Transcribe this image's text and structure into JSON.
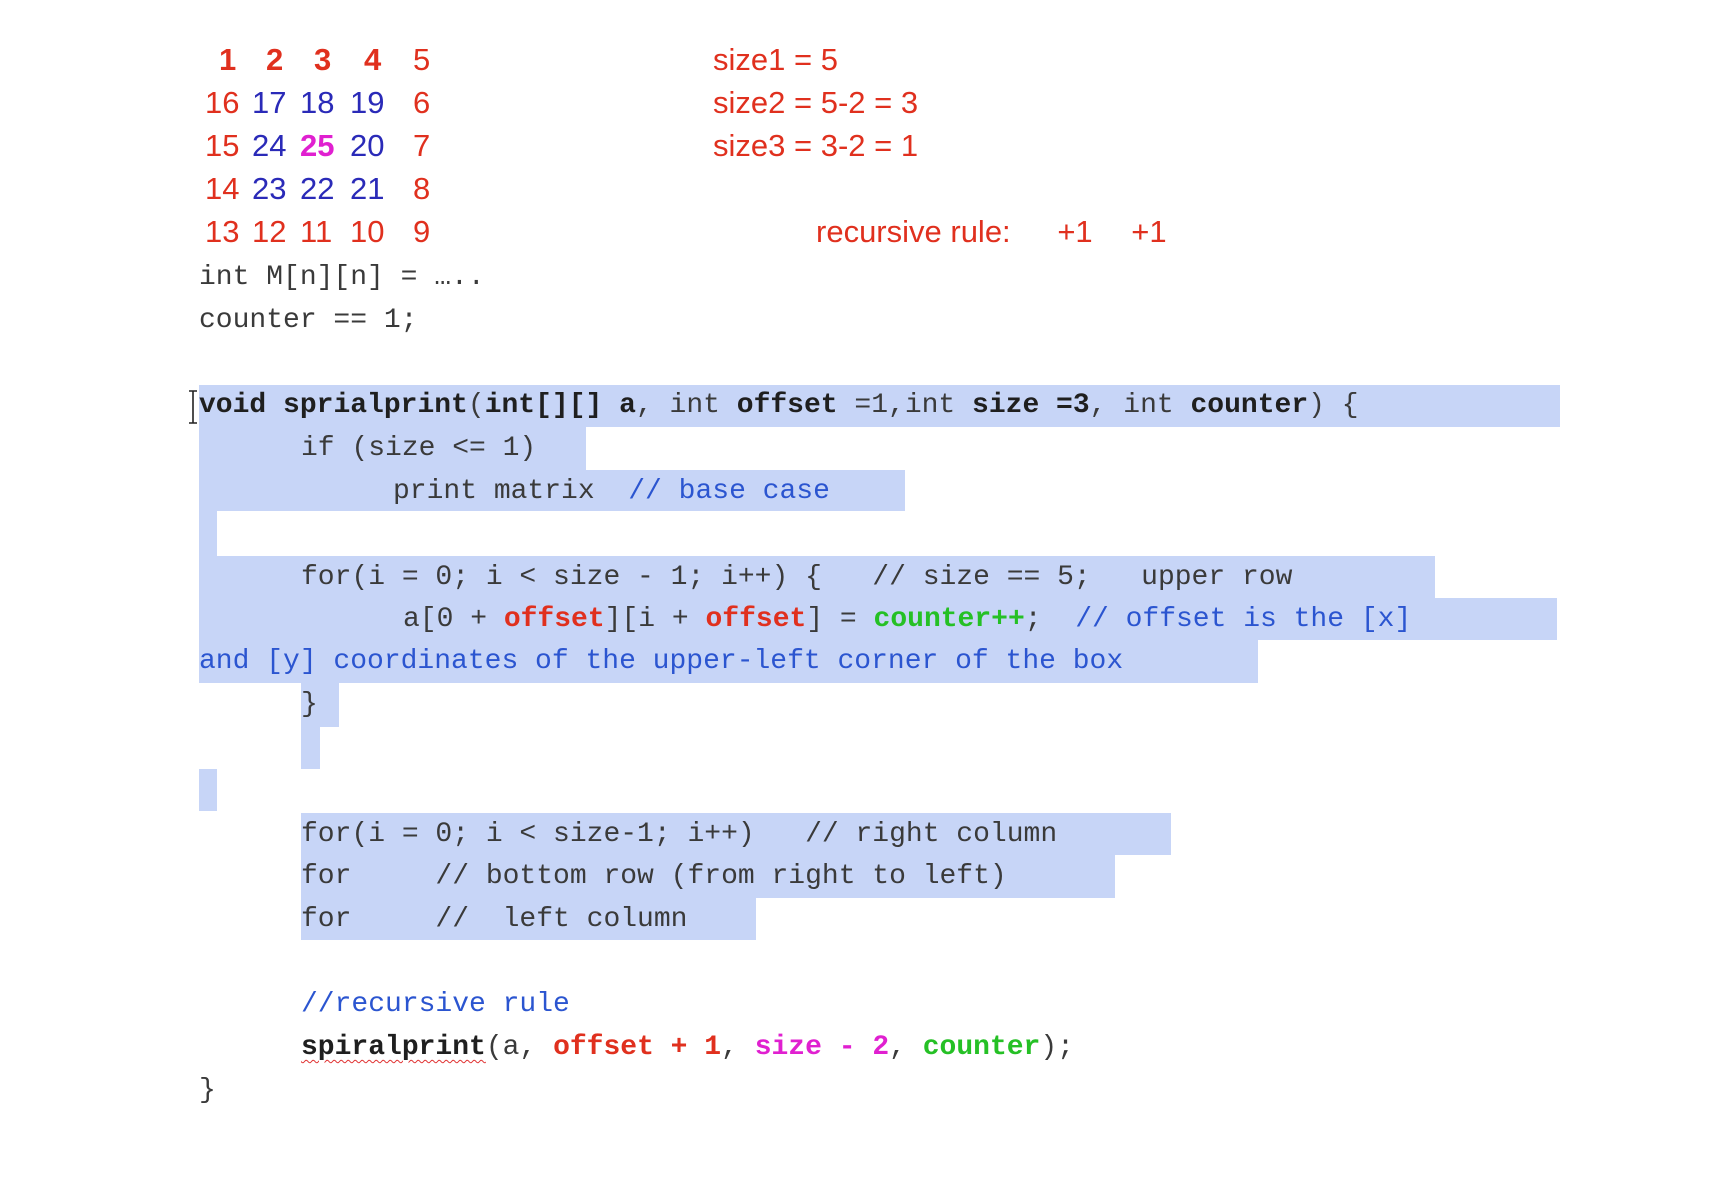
{
  "matrix": {
    "rows": [
      [
        {
          "t": "1",
          "c": "#e0301e",
          "b": true
        },
        {
          "t": "2",
          "c": "#e0301e",
          "b": true
        },
        {
          "t": "3",
          "c": "#e0301e",
          "b": true
        },
        {
          "t": "4",
          "c": "#e0301e",
          "b": true
        },
        {
          "t": "5",
          "c": "#e0301e",
          "b": false
        }
      ],
      [
        {
          "t": "16",
          "c": "#e0301e",
          "b": false
        },
        {
          "t": "17",
          "c": "#2a2ab8",
          "b": false
        },
        {
          "t": "18",
          "c": "#2a2ab8",
          "b": false
        },
        {
          "t": "19",
          "c": "#2a2ab8",
          "b": false
        },
        {
          "t": "6",
          "c": "#e0301e",
          "b": false
        }
      ],
      [
        {
          "t": "15",
          "c": "#e0301e",
          "b": false
        },
        {
          "t": "24",
          "c": "#2a2ab8",
          "b": false
        },
        {
          "t": "25",
          "c": "#e020d0",
          "b": true
        },
        {
          "t": "20",
          "c": "#2a2ab8",
          "b": false
        },
        {
          "t": "7",
          "c": "#e0301e",
          "b": false
        }
      ],
      [
        {
          "t": "14",
          "c": "#e0301e",
          "b": false
        },
        {
          "t": "23",
          "c": "#2a2ab8",
          "b": false
        },
        {
          "t": "22",
          "c": "#2a2ab8",
          "b": false
        },
        {
          "t": "21",
          "c": "#2a2ab8",
          "b": false
        },
        {
          "t": "8",
          "c": "#e0301e",
          "b": false
        }
      ],
      [
        {
          "t": "13",
          "c": "#e0301e",
          "b": false
        },
        {
          "t": "12",
          "c": "#e0301e",
          "b": false
        },
        {
          "t": "11",
          "c": "#e0301e",
          "b": false
        },
        {
          "t": "10",
          "c": "#e0301e",
          "b": false
        },
        {
          "t": "9",
          "c": "#e0301e",
          "b": false
        }
      ]
    ]
  },
  "sizes": [
    "size1 = 5",
    "size2 = 5-2 = 3",
    "size3 = 3-2 = 1"
  ],
  "recursive_rule": {
    "label": "recursive rule:",
    "v1": "+1",
    "v2": "+1"
  },
  "code": {
    "l1": "int M[n][n] = …..",
    "l2": "counter == 1;",
    "sig": {
      "void": "void",
      "name": "sprialprint",
      "p1": "(",
      "type1": "int[][]",
      "sp1": " ",
      "a": "a",
      "c1": ", ",
      "int2": "int ",
      "offset": "offset",
      "eq1": " =1,",
      "int3": "int ",
      "size": "size",
      "eq3": " =3",
      "c2": ", ",
      "int4": "int ",
      "counter": "counter",
      "close": ") {"
    },
    "if_line": "if (size <= 1)",
    "print_line": "print matrix  ",
    "base_case": "// base case",
    "for1": "for(i = 0; i < size - 1; i++) {   ",
    "for1_cmt": "// size == 5;   upper row",
    "assign": {
      "a0": "a[0 + ",
      "off1": "offset",
      "mid": "][i + ",
      "off2": "offset",
      "eq": "] = ",
      "cnt": "counter++",
      "semi": ";  ",
      "cmt": "// offset is the [x]"
    },
    "cont_cmt": "and [y] coordinates of the upper-left corner of the box",
    "close_brace": "}",
    "for_right": "for(i = 0; i < size-1; i++)   // right column",
    "for_bottom": "for     // bottom row (from right to left)",
    "for_left": "for     //  left column",
    "rec_cmt": "//recursive rule",
    "call": {
      "name": "spiralprint",
      "p": "(a, ",
      "off": "offset + 1",
      "c1": ", ",
      "size": "size - 2",
      "c2": ", ",
      "cnt": "counter",
      "end": ");"
    },
    "final_brace": "}"
  }
}
